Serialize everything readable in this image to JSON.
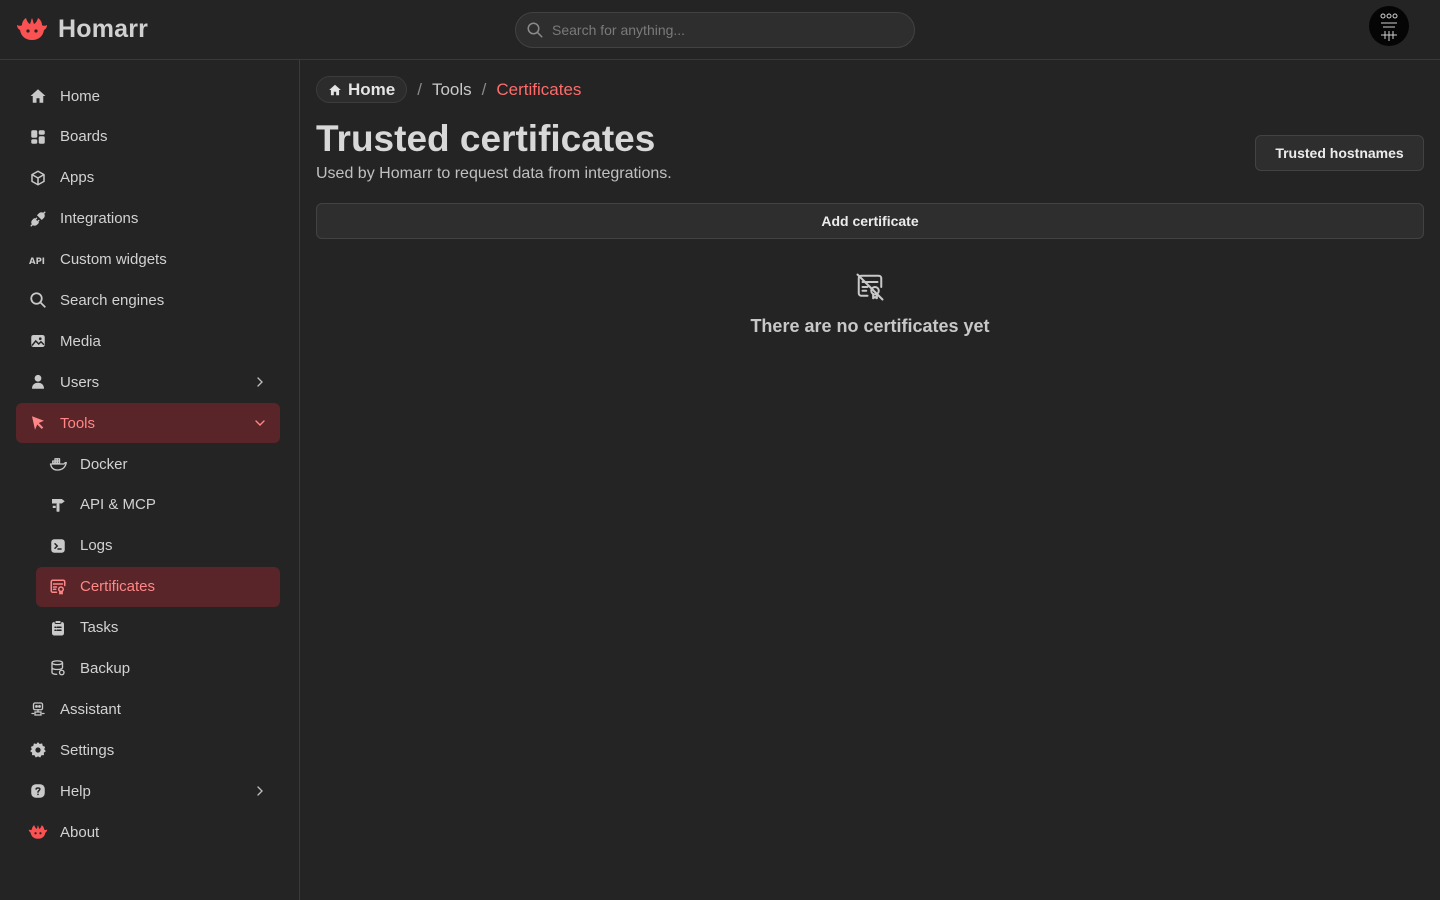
{
  "app": {
    "name": "Homarr",
    "accent": "#fa5252"
  },
  "search": {
    "placeholder": "Search for anything..."
  },
  "sidebar": {
    "items": [
      {
        "label": "Home",
        "icon": "home-icon"
      },
      {
        "label": "Boards",
        "icon": "layout-dashboard-icon"
      },
      {
        "label": "Apps",
        "icon": "box-icon"
      },
      {
        "label": "Integrations",
        "icon": "plug-connected-icon"
      },
      {
        "label": "Custom widgets",
        "icon": "api-icon"
      },
      {
        "label": "Search engines",
        "icon": "search-icon"
      },
      {
        "label": "Media",
        "icon": "photo-icon"
      },
      {
        "label": "Users",
        "icon": "user-icon"
      },
      {
        "label": "Tools",
        "icon": "pointer-icon"
      },
      {
        "label": "Docker",
        "icon": "docker-icon"
      },
      {
        "label": "API & MCP",
        "icon": "api-hammer-icon"
      },
      {
        "label": "Logs",
        "icon": "terminal-icon"
      },
      {
        "label": "Certificates",
        "icon": "certificate-icon"
      },
      {
        "label": "Tasks",
        "icon": "clipboard-list-icon"
      },
      {
        "label": "Backup",
        "icon": "database-icon"
      },
      {
        "label": "Assistant",
        "icon": "robot-icon"
      },
      {
        "label": "Settings",
        "icon": "gear-icon"
      },
      {
        "label": "Help",
        "icon": "question-icon"
      },
      {
        "label": "About",
        "icon": "homarr-logo-icon"
      }
    ]
  },
  "breadcrumb": {
    "home": "Home",
    "separator": "/",
    "tools": "Tools",
    "current": "Certificates"
  },
  "page": {
    "title": "Trusted certificates",
    "subtitle": "Used by Homarr to request data from integrations.",
    "hostnames_button": "Trusted hostnames",
    "add_button": "Add certificate",
    "empty_text": "There are no certificates yet"
  }
}
